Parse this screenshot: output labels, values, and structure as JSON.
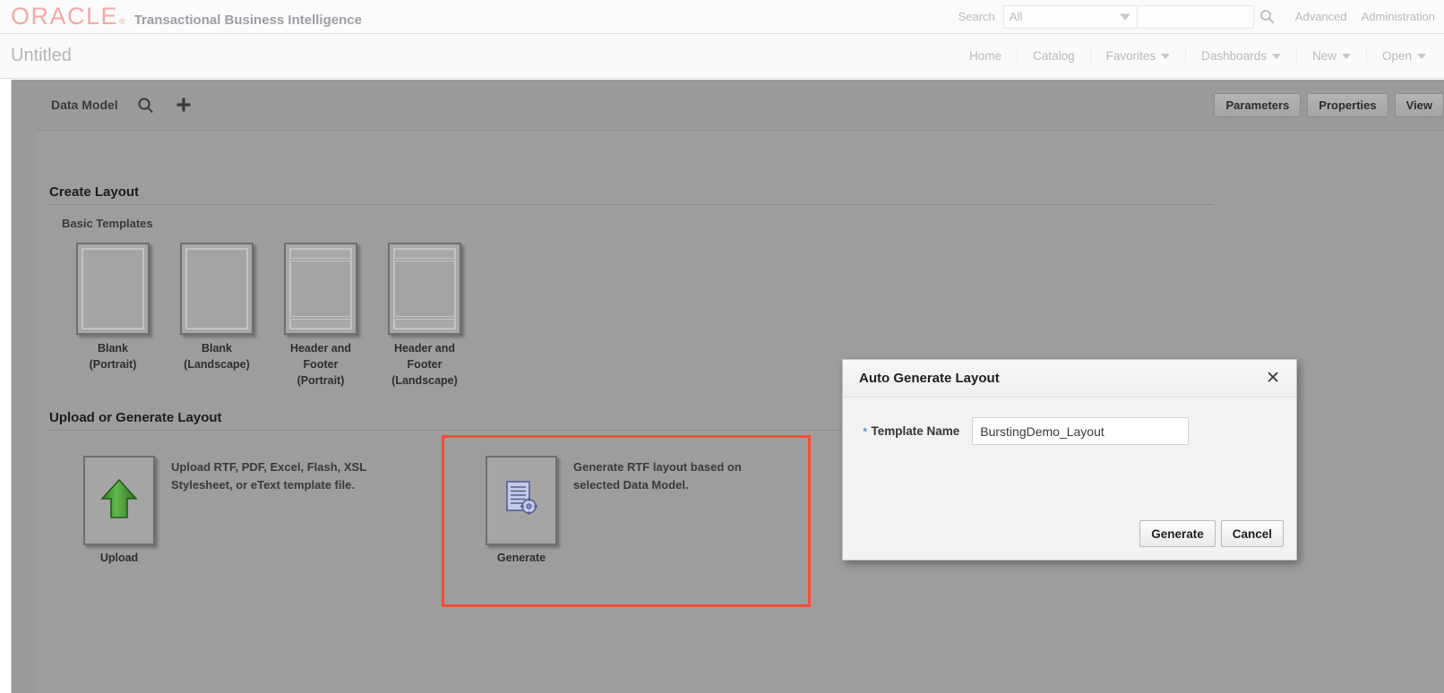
{
  "header": {
    "brand": "ORACLE",
    "brand_mark": "®",
    "app_title": "Transactional Business Intelligence",
    "search_label": "Search",
    "search_scope": "All",
    "search_value": "",
    "search_placeholder": "",
    "search_icon": "search-icon",
    "links": [
      "Advanced",
      "Administration"
    ]
  },
  "titlebar": {
    "page_title": "Untitled",
    "nav": [
      {
        "label": "Home",
        "caret": false
      },
      {
        "label": "Catalog",
        "caret": false
      },
      {
        "label": "Favorites",
        "caret": true
      },
      {
        "label": "Dashboards",
        "caret": true
      },
      {
        "label": "New",
        "caret": true
      },
      {
        "label": "Open",
        "caret": true
      }
    ]
  },
  "toolbar": {
    "data_model_label": "Data Model",
    "search_icon": "search-icon",
    "add_icon": "plus-icon",
    "buttons": [
      "Parameters",
      "Properties",
      "View"
    ]
  },
  "create_layout": {
    "heading": "Create Layout",
    "subheading": "Basic Templates",
    "templates": [
      {
        "caption": "Blank\n(Portrait)",
        "kind": "blank",
        "orientation": "portrait"
      },
      {
        "caption": "Blank\n(Landscape)",
        "kind": "blank",
        "orientation": "landscape"
      },
      {
        "caption": "Header and Footer\n(Portrait)",
        "kind": "header-footer",
        "orientation": "portrait"
      },
      {
        "caption": "Header and Footer\n(Landscape)",
        "kind": "header-footer",
        "orientation": "landscape"
      }
    ]
  },
  "upload_generate": {
    "heading": "Upload or Generate Layout",
    "upload": {
      "caption": "Upload",
      "icon": "green-up-arrow-icon",
      "description": "Upload RTF, PDF, Excel, Flash, XSL Stylesheet, or eText template file."
    },
    "generate": {
      "caption": "Generate",
      "icon": "document-gear-icon",
      "description": "Generate RTF layout based on selected Data Model.",
      "highlight_color": "#fb4a38"
    }
  },
  "modal": {
    "title": "Auto Generate Layout",
    "close_icon": "✕",
    "required_marker": "*",
    "field_label": "Template Name",
    "field_value": "BurstingDemo_Layout",
    "field_placeholder": "",
    "primary_button": "Generate",
    "secondary_button": "Cancel"
  }
}
